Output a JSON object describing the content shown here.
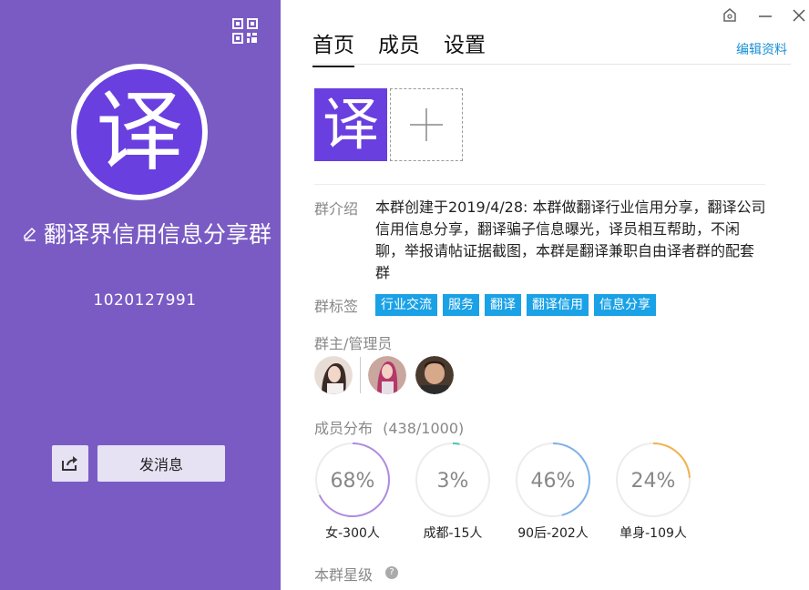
{
  "left": {
    "avatar_char": "译",
    "group_name": "翻译界信用信息分享群",
    "group_id": "1020127991",
    "send_label": "发消息"
  },
  "tabs": [
    {
      "label": "首页",
      "active": true
    },
    {
      "label": "成员",
      "active": false
    },
    {
      "label": "设置",
      "active": false
    }
  ],
  "edit_profile": "编辑资料",
  "thumb_char": "译",
  "intro": {
    "label": "群介绍",
    "text": "本群创建于2019/4/28: 本群做翻译行业信用分享，翻译公司信用信息分享，翻译骗子信息曝光，译员相互帮助，不闲聊，举报请帖证据截图，本群是翻译兼职自由译者群的配套群"
  },
  "tags": {
    "label": "群标签",
    "items": [
      "行业交流",
      "服务",
      "翻译",
      "翻译信用",
      "信息分享"
    ]
  },
  "admins_label": "群主/管理员",
  "distribution": {
    "title": "成员分布",
    "count": "(438/1000)",
    "rings": [
      {
        "percent": "68%",
        "value": 0.68,
        "label": "女-300人",
        "color": "#b08ce0"
      },
      {
        "percent": "3%",
        "value": 0.03,
        "label": "成都-15人",
        "color": "#4fc3b8"
      },
      {
        "percent": "46%",
        "value": 0.46,
        "label": "90后-202人",
        "color": "#7fb2e8"
      },
      {
        "percent": "24%",
        "value": 0.24,
        "label": "单身-109人",
        "color": "#f2b24c"
      }
    ]
  },
  "star_label": "本群星级",
  "colors": {
    "sidebar": "#7a5bc4",
    "accent": "#1aa1e6",
    "brand": "#6a3fe0"
  }
}
